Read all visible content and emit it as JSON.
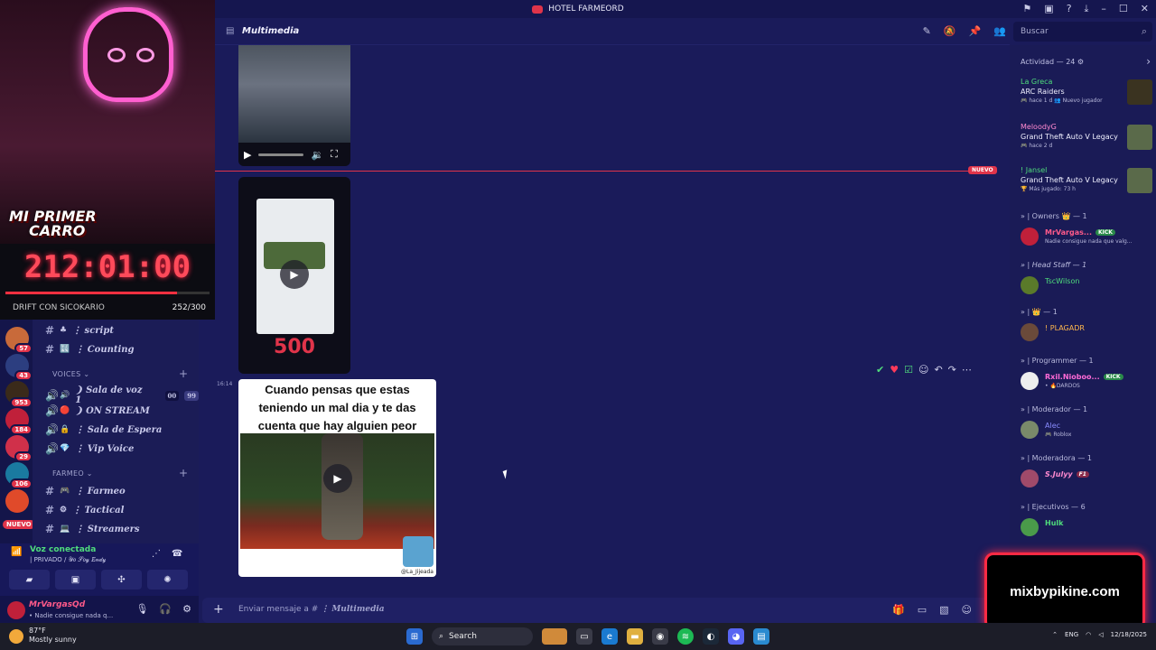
{
  "window": {
    "title": "HOTEL FARMEORD"
  },
  "overlay": {
    "logo_line1": "MI PRIMER",
    "logo_line2": "CARRO",
    "timer": "212:01:00",
    "label": "DRIFT CON SICOKARIO",
    "count": "252/300",
    "progress": 0.84
  },
  "servers": {
    "badges": [
      "57",
      "43",
      "953",
      "184",
      "29",
      "106",
      "",
      ""
    ],
    "new_label": "NUEVO"
  },
  "channels": [
    {
      "emoji": "♣",
      "name": "⋮ script"
    },
    {
      "emoji": "🔣",
      "name": "⋮ Counting"
    }
  ],
  "voices_category": "VOICES",
  "voice_channels": [
    {
      "emoji": "🔊",
      "name": "❩ Sala de voz 1",
      "tag1": "00",
      "tag2": "99"
    },
    {
      "emoji": "🔴",
      "name": "❩ ON STREAM"
    },
    {
      "emoji": "🔒",
      "name": "⋮ Sala de Espera"
    },
    {
      "emoji": "💎",
      "name": "⋮ Vip Voice"
    }
  ],
  "farmeo_category": "FARMEO",
  "farmeo_channels": [
    {
      "emoji": "🎮",
      "name": "⋮ Farmeo"
    },
    {
      "emoji": "⚙",
      "name": "⋮ Tactical"
    },
    {
      "emoji": "💻",
      "name": "⋮ Streamers"
    }
  ],
  "voice_status": {
    "title": "Voz conectada",
    "sub": "| PRIVADO / 𝒴𝑜 𝒮𝑜𝓎 𝐸𝓃𝒹𝓎"
  },
  "user": {
    "name": "MrVargasQd",
    "status": "• Nadie consigue nada q..."
  },
  "header": {
    "channel": "Multimedia",
    "search_placeholder": "Buscar"
  },
  "chat": {
    "new_tag": "NUEVO",
    "timestamp": "16:14",
    "casino": "500",
    "meme_caption": "Cuando pensas que estas teniendo un mal dia y te das cuenta que hay alguien peor",
    "meme_handle": "@La_Jijeada"
  },
  "composer": {
    "placeholder_prefix": "Enviar mensaje a # ",
    "placeholder_channel": "⋮ Multimedia"
  },
  "members": {
    "activity_header": "Actividad — 24 ⚙",
    "activities": [
      {
        "user": "La Greca",
        "game": "ARC Raiders",
        "sub": "🎮 hace 1 d  👥 Nuevo jugador"
      },
      {
        "user": "MeloodyG",
        "game": "Grand Theft Auto V Legacy",
        "sub": "🎮 hace 2 d"
      },
      {
        "user": "! Jansel",
        "game": "Grand Theft Auto V Legacy",
        "sub": "🏆 Más jugado: 73 h"
      }
    ],
    "groups": [
      {
        "title": "» | Owners 👑 — 1"
      },
      {
        "title": "» | Head Staff — 1"
      },
      {
        "title": "» | 👑 — 1"
      },
      {
        "title": "» | Programmer — 1"
      },
      {
        "title": "» | Moderador — 1"
      },
      {
        "title": "» | Moderadora — 1"
      },
      {
        "title": "» | Ejecutivos — 6"
      }
    ],
    "people": [
      {
        "name": "MrVargas...",
        "status": "Nadie consigue nada que valg...",
        "kick": "KICK",
        "color": "#ff5a8a"
      },
      {
        "name": "TscWilson",
        "status": "",
        "kick": "",
        "color": "#4fdc7c"
      },
      {
        "name": "! PLAGADR",
        "status": "",
        "kick": "",
        "color": "#ffb84d"
      },
      {
        "name": "Rxil.Nioboo...",
        "status": "• 🔥DARDOS",
        "kick": "KICK",
        "color": "#ff6ad6"
      },
      {
        "name": "Alec",
        "status": "🎮 Roblox",
        "kick": "",
        "color": "#8a8cff"
      },
      {
        "name": "S.Julyy",
        "status": "",
        "kick": "F1",
        "color": "#ff8ad0"
      },
      {
        "name": "Hulk",
        "status": "",
        "kick": "",
        "color": "#4fdc7c"
      }
    ]
  },
  "promo": {
    "text": "mixbypikine.com"
  },
  "taskbar": {
    "temp": "87°F",
    "weather": "Mostly sunny",
    "search": "Search",
    "lang": "ENG",
    "date": "12/18/2025"
  }
}
